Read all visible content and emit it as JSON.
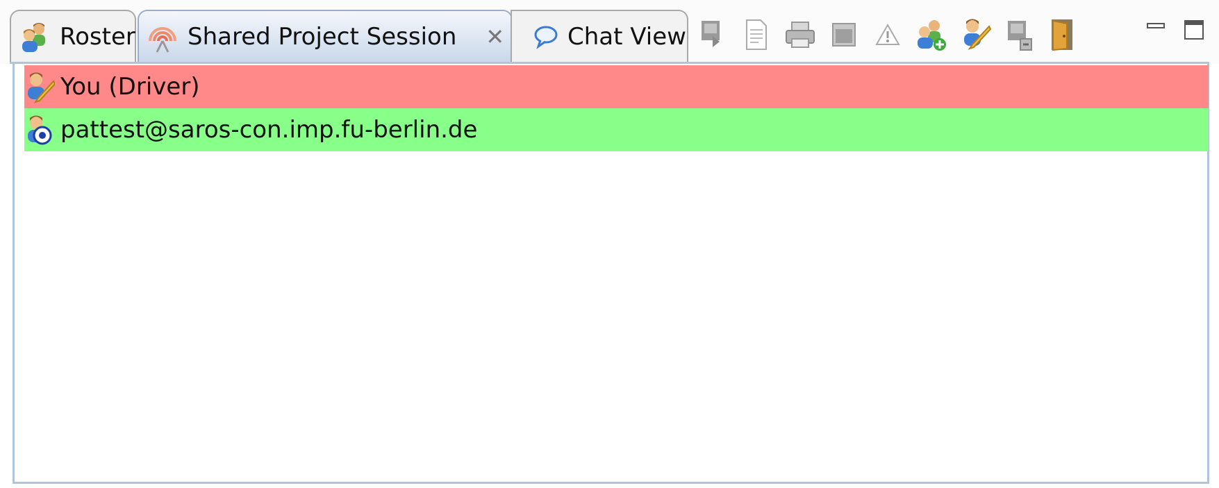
{
  "tabs": [
    {
      "label": "Roster",
      "icon": "roster-icon",
      "active": false
    },
    {
      "label": "Shared Project Session",
      "icon": "shared-session-icon",
      "active": true,
      "closable": true
    },
    {
      "label": "Chat View",
      "icon": "chat-bubble-icon",
      "active": false
    }
  ],
  "toolbar_icons": [
    "leave-session-icon",
    "document-icon",
    "printer-icon",
    "console-icon",
    "alert-icon",
    "add-buddy-icon",
    "driver-pencil-icon",
    "restrict-driver-icon",
    "exit-door-icon"
  ],
  "window_controls": [
    "minimize-icon",
    "maximize-icon"
  ],
  "participants": [
    {
      "label": "You (Driver)",
      "role": "driver",
      "color": "#ff8888"
    },
    {
      "label": "pattest@saros-con.imp.fu-berlin.de",
      "role": "observer",
      "color": "#88ff88"
    }
  ],
  "colors": {
    "active_tab_border": "#98aed0",
    "view_border": "#b3c4da"
  }
}
